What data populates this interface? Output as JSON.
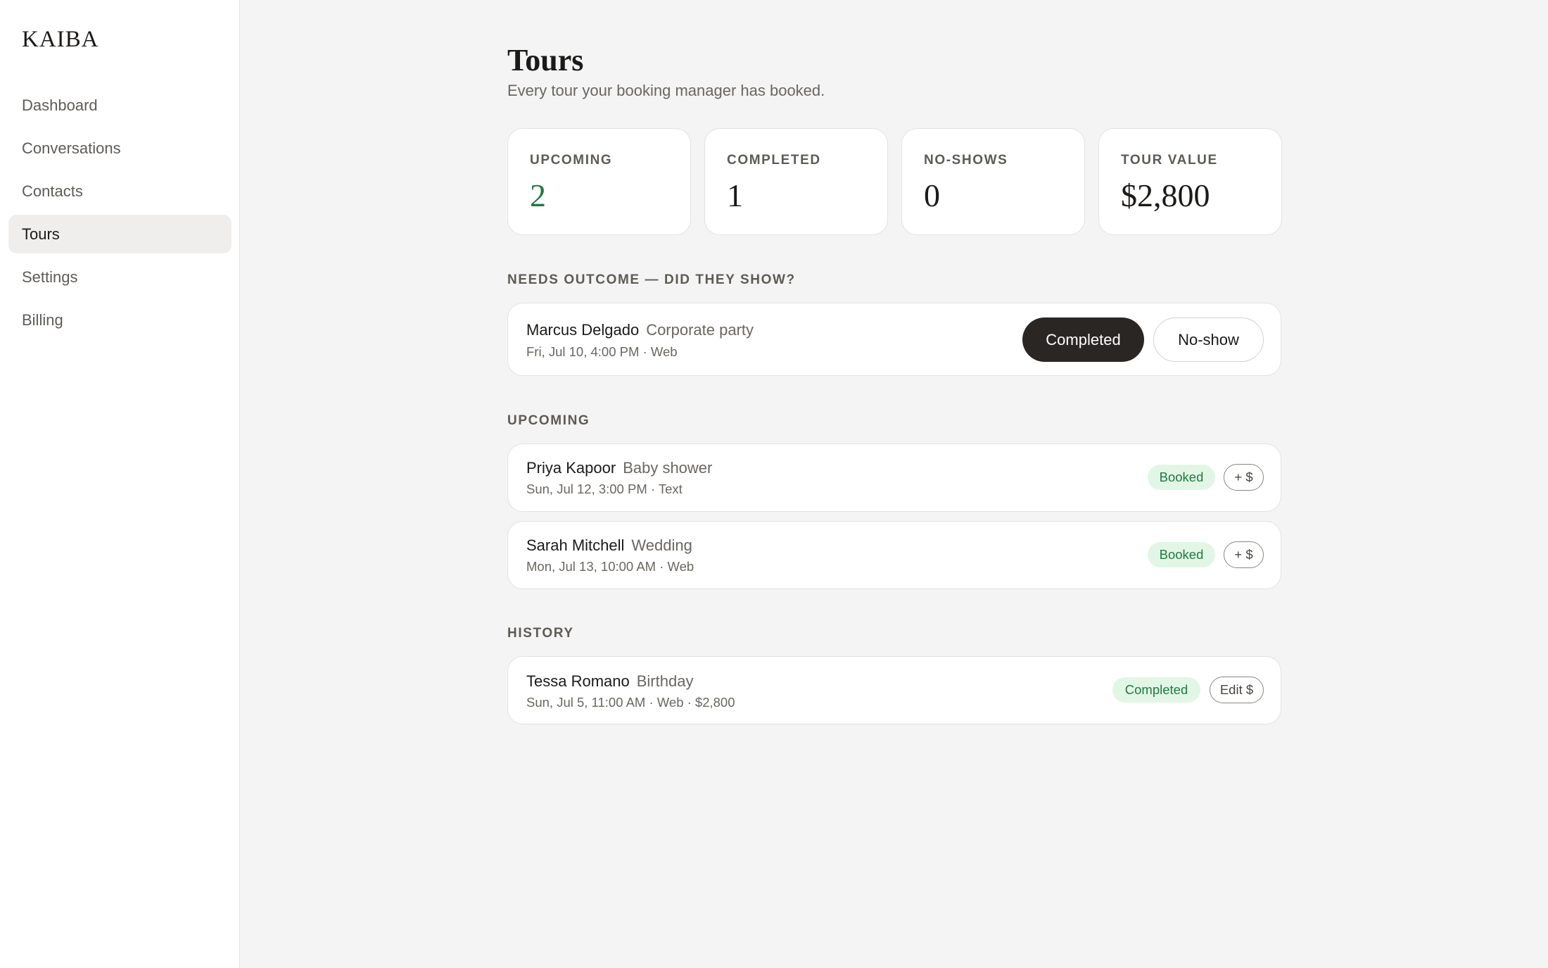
{
  "brand": "KAIBA",
  "sidebar": {
    "items": [
      {
        "label": "Dashboard"
      },
      {
        "label": "Conversations"
      },
      {
        "label": "Contacts"
      },
      {
        "label": "Tours",
        "active": true
      },
      {
        "label": "Settings"
      },
      {
        "label": "Billing"
      }
    ]
  },
  "page": {
    "title": "Tours",
    "subtitle": "Every tour your booking manager has booked."
  },
  "stats": [
    {
      "label": "UPCOMING",
      "value": "2"
    },
    {
      "label": "COMPLETED",
      "value": "1"
    },
    {
      "label": "NO-SHOWS",
      "value": "0"
    },
    {
      "label": "TOUR VALUE",
      "value": "$2,800"
    }
  ],
  "needs_outcome": {
    "label": "NEEDS OUTCOME — DID THEY SHOW?",
    "item": {
      "name": "Marcus Delgado",
      "type": "Corporate party",
      "meta": "Fri, Jul 10, 4:00 PM · Web",
      "completed_label": "Completed",
      "noshow_label": "No-show"
    }
  },
  "upcoming": {
    "label": "UPCOMING",
    "items": [
      {
        "name": "Priya Kapoor",
        "type": "Baby shower",
        "meta": "Sun, Jul 12, 3:00 PM · Text",
        "status": "Booked",
        "action": "+ $"
      },
      {
        "name": "Sarah Mitchell",
        "type": "Wedding",
        "meta": "Mon, Jul 13, 10:00 AM · Web",
        "status": "Booked",
        "action": "+ $"
      }
    ]
  },
  "history": {
    "label": "HISTORY",
    "items": [
      {
        "name": "Tessa Romano",
        "type": "Birthday",
        "meta": "Sun, Jul 5, 11:00 AM · Web · $2,800",
        "status": "Completed",
        "action": "Edit $"
      }
    ]
  },
  "colors": {
    "accent_green": "#1f7a3e",
    "badge_bg": "#e2f6e6",
    "dark_button": "#2a2623",
    "page_bg": "#f4f4f4"
  }
}
